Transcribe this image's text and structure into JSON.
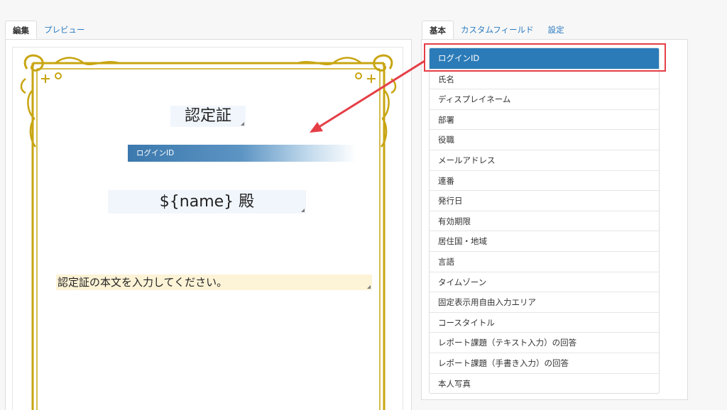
{
  "editor": {
    "tabs": [
      {
        "label": "編集",
        "active": true
      },
      {
        "label": "プレビュー",
        "active": false
      }
    ],
    "certificate": {
      "title": "認定証",
      "login_field": "ログインID",
      "name_field": "${name} 殿",
      "body_placeholder": "認定証の本文を入力してください。"
    },
    "frame_color": "#c8a512"
  },
  "fields_panel": {
    "tabs": [
      {
        "label": "基本",
        "active": true
      },
      {
        "label": "カスタムフィールド",
        "active": false
      },
      {
        "label": "設定",
        "active": false
      }
    ],
    "items": [
      "ログインID",
      "氏名",
      "ディスプレイネーム",
      "部署",
      "役職",
      "メールアドレス",
      "連番",
      "発行日",
      "有効期限",
      "居住国・地域",
      "言語",
      "タイムゾーン",
      "固定表示用自由入力エリア",
      "コースタイトル",
      "レポート課題（テキスト入力）の回答",
      "レポート課題（手書き入力）の回答",
      "本人写真"
    ],
    "selected_index": 0,
    "selected_color": "#2b7bb8"
  },
  "annotation": {
    "color": "#e53e46"
  }
}
